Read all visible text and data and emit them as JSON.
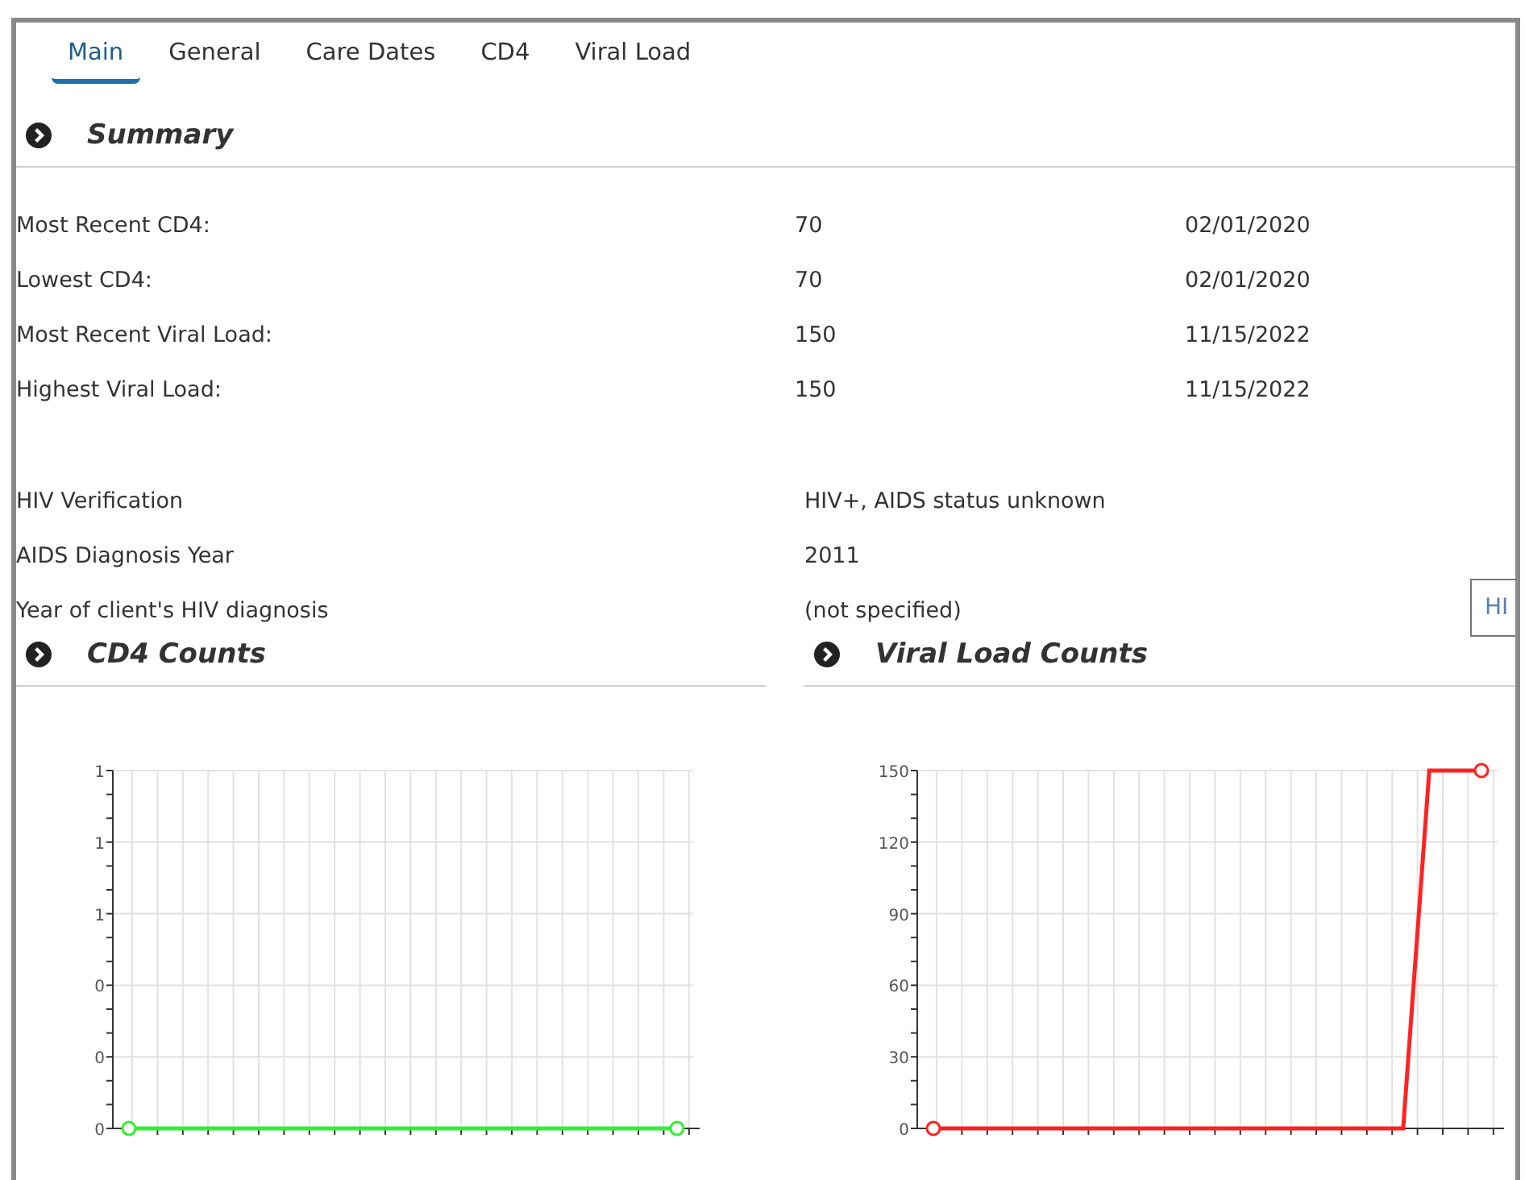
{
  "tabs": [
    {
      "label": "Main",
      "selected": true
    },
    {
      "label": "General",
      "selected": false
    },
    {
      "label": "Care Dates",
      "selected": false
    },
    {
      "label": "CD4",
      "selected": false
    },
    {
      "label": "Viral Load",
      "selected": false
    }
  ],
  "summary": {
    "title": "Summary",
    "lab_rows": [
      {
        "label": "Most Recent CD4:",
        "value": "70",
        "date": "02/01/2020"
      },
      {
        "label": "Lowest CD4:",
        "value": "70",
        "date": "02/01/2020"
      },
      {
        "label": "Most Recent Viral Load:",
        "value": "150",
        "date": "11/15/2022"
      },
      {
        "label": "Highest Viral Load:",
        "value": "150",
        "date": "11/15/2022"
      }
    ],
    "diagnosis_rows": [
      {
        "label": "HIV Verification",
        "value": "HIV+, AIDS status unknown"
      },
      {
        "label": "AIDS Diagnosis Year",
        "value": "2011"
      },
      {
        "label": "Year of client's HIV diagnosis",
        "value": "(not specified)"
      }
    ]
  },
  "side_button": {
    "label": "HI"
  },
  "panels": [
    {
      "title": "CD4 Counts",
      "chart_data": {
        "type": "line",
        "grid": true,
        "categories": [
          null,
          null,
          null,
          null,
          null,
          null,
          null,
          null,
          null,
          null,
          null,
          null,
          null,
          null,
          null,
          null,
          null,
          null,
          null,
          null,
          null,
          null
        ],
        "series": [
          {
            "color": "#33ee33",
            "values": [
              0,
              0,
              0,
              0,
              0,
              0,
              0,
              0,
              0,
              0,
              0,
              0,
              0,
              0,
              0,
              0,
              0,
              0,
              0,
              0,
              0,
              0
            ]
          }
        ],
        "ylim": [
          0,
          1
        ],
        "yticks": [
          {
            "value": 0,
            "label": "0"
          },
          {
            "value": 0.2,
            "label": "0"
          },
          {
            "value": 0.4,
            "label": "0"
          },
          {
            "value": 0.6,
            "label": "1"
          },
          {
            "value": 0.8,
            "label": "1"
          },
          {
            "value": 1,
            "label": "1"
          }
        ]
      }
    },
    {
      "title": "Viral Load Counts",
      "chart_data": {
        "type": "line",
        "grid": true,
        "categories": [
          null,
          null,
          null,
          null,
          null,
          null,
          null,
          null,
          null,
          null,
          null,
          null,
          null,
          null,
          null,
          null,
          null,
          null,
          null,
          null,
          null,
          null
        ],
        "series": [
          {
            "color": "#ff2222",
            "values": [
              0,
              0,
              0,
              0,
              0,
              0,
              0,
              0,
              0,
              0,
              0,
              0,
              0,
              0,
              0,
              0,
              0,
              0,
              0,
              150,
              150,
              150
            ]
          }
        ],
        "ylim": [
          0,
          150
        ],
        "yticks": [
          0,
          30,
          60,
          90,
          120,
          150
        ]
      }
    }
  ]
}
